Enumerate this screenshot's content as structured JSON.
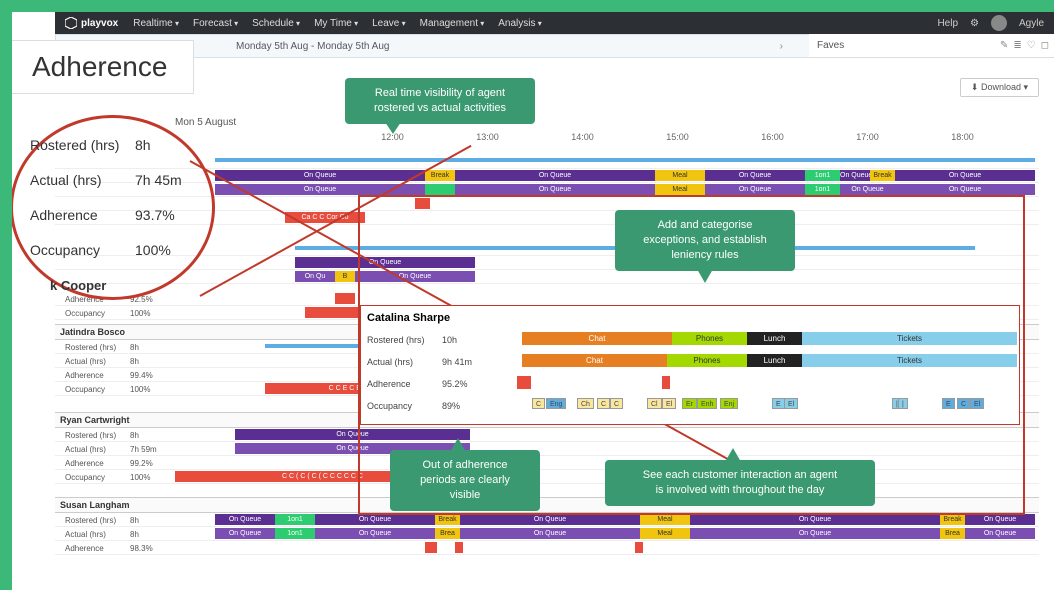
{
  "app": {
    "name": "playvox"
  },
  "nav": {
    "items": [
      "Realtime",
      "Forecast",
      "Schedule",
      "My Time",
      "Leave",
      "Management",
      "Analysis"
    ],
    "help": "Help",
    "user": "Agyle"
  },
  "datebar": {
    "range": "Monday 5th Aug - Monday 5th Aug"
  },
  "faves": {
    "label": "Faves"
  },
  "download": {
    "label": "⬇ Download ▾"
  },
  "title": "Adherence",
  "stats_mag": {
    "rostered_lbl": "Rostered (hrs)",
    "rostered_val": "8h",
    "actual_lbl": "Actual (hrs)",
    "actual_val": "7h 45m",
    "adherence_lbl": "Adherence",
    "adherence_val": "93.7%",
    "occupancy_lbl": "Occupancy",
    "occupancy_val": "100%"
  },
  "timeline": {
    "date": "Mon 5 August",
    "hours": [
      "12:00",
      "13:00",
      "14:00",
      "15:00",
      "16:00",
      "17:00",
      "18:00"
    ]
  },
  "activities": {
    "on_queue": "On Queue",
    "break": "Break",
    "meal": "Meal",
    "one_on_one": "1on1",
    "chat": "Chat",
    "phones": "Phones",
    "lunch": "Lunch",
    "tickets": "Tickets"
  },
  "agents": {
    "cooper": {
      "name": "k Cooper",
      "adherence_lbl": "Adherence",
      "adherence_val": "92.5%",
      "occupancy_lbl": "Occupancy",
      "occupancy_val": "100%"
    },
    "bosco": {
      "name": "Jatindra Bosco",
      "rostered": "8h",
      "actual": "8h",
      "adherence": "99.4%",
      "occupancy": "100%"
    },
    "cartwright": {
      "name": "Ryan Cartwright",
      "rostered": "8h",
      "actual": "7h 59m",
      "adherence": "99.2%",
      "occupancy": "100%"
    },
    "langham": {
      "name": "Susan Langham",
      "rostered": "8h",
      "actual": "8h",
      "adherence": "98.3%"
    }
  },
  "labels": {
    "rostered": "Rostered (hrs)",
    "actual": "Actual (hrs)",
    "adherence": "Adherence",
    "occupancy": "Occupancy"
  },
  "detail": {
    "name": "Catalina Sharpe",
    "rostered": "10h",
    "actual": "9h 41m",
    "adherence": "95.2%",
    "occupancy": "89%"
  },
  "callouts": {
    "c1": "Real time visibility of agent\nrostered vs actual activities",
    "c2": "Add and categorise\nexceptions, and establish\nleniency rules",
    "c3": "Out of adherence\nperiods are clearly\nvisible",
    "c4": "See each customer interaction an agent\nis involved with throughout the day"
  }
}
